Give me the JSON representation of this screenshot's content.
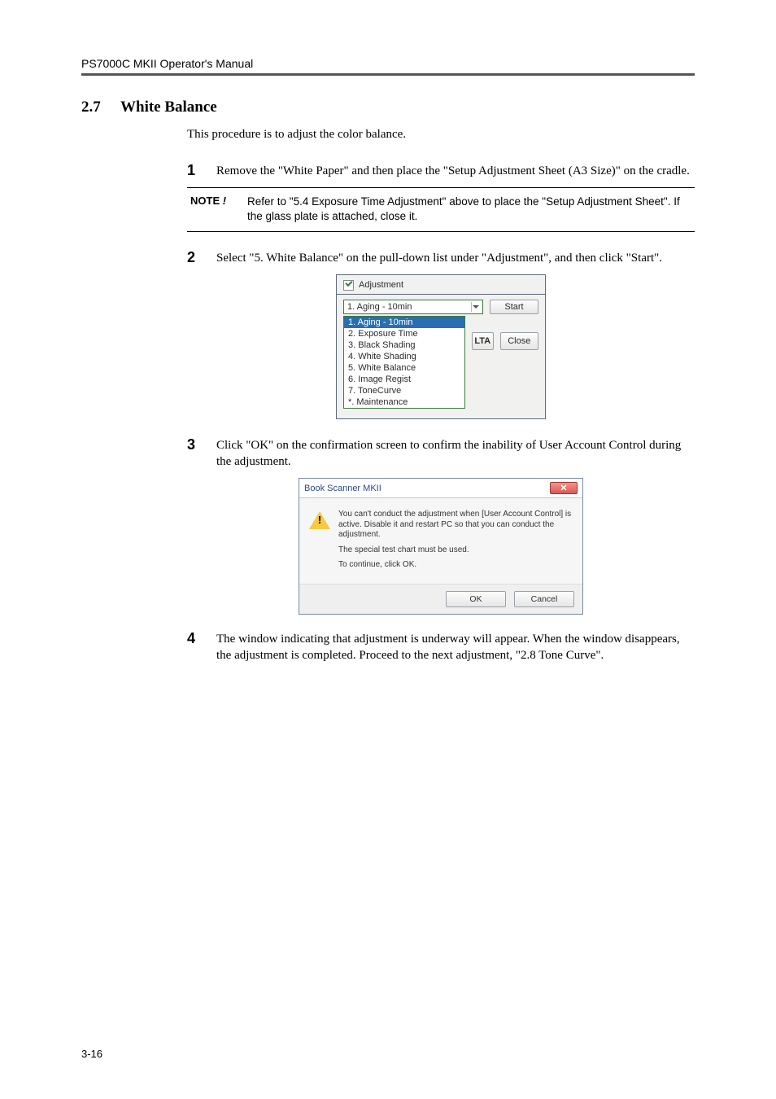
{
  "header": "PS7000C MKII Operator's Manual",
  "section": {
    "number": "2.7",
    "title": "White Balance"
  },
  "intro": "This procedure is to adjust the color balance.",
  "steps": {
    "s1": {
      "num": "1",
      "text": "Remove the \"White Paper\" and then place the \"Setup Adjustment Sheet (A3 Size)\" on the cradle."
    },
    "s2": {
      "num": "2",
      "text": "Select \"5. White Balance\" on the pull-down list under \"Adjustment\", and then click \"Start\"."
    },
    "s3": {
      "num": "3",
      "text": "Click \"OK\" on the confirmation screen to confirm the inability of User Account Control during the adjustment."
    },
    "s4": {
      "num": "4",
      "text": "The window indicating that adjustment is underway will appear. When the window disappears, the adjustment is completed. Proceed to the next adjustment, \"2.8 Tone Curve\"."
    }
  },
  "note": {
    "label": "NOTE",
    "bang": "!",
    "text": "Refer to \"5.4 Exposure Time Adjustment\" above to place the \"Setup Adjustment Sheet\". If the glass plate is attached, close it."
  },
  "shot1": {
    "title": "Adjustment",
    "selected": "1. Aging - 10min",
    "start": "Start",
    "lta": "LTA",
    "close": "Close",
    "options": {
      "o0": "1. Aging - 10min",
      "o1": "2. Exposure Time",
      "o2": "3. Black Shading",
      "o3": "4. White Shading",
      "o4": "5. White Balance",
      "o5": "6. Image Regist",
      "o6": "7. ToneCurve",
      "o7": "*. Maintenance"
    }
  },
  "shot2": {
    "title": "Book Scanner MKII",
    "msg1": "You can't conduct the adjustment when [User Account Control] is active.   Disable it and restart PC so that you can conduct the adjustment.",
    "msg2": "The special test chart must be used.",
    "msg3": "To continue, click OK.",
    "ok": "OK",
    "cancel": "Cancel"
  },
  "page_number": "3-16"
}
